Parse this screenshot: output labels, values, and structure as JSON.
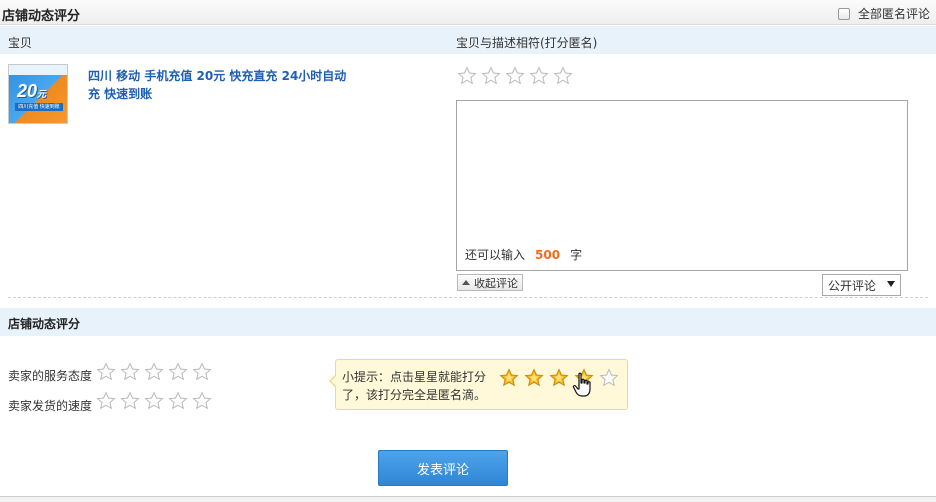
{
  "header": {
    "title": "店铺动态评分",
    "anonymous_label": "全部匿名评论"
  },
  "columns": {
    "item": "宝贝",
    "match": "宝贝与描述相符(打分匿名)"
  },
  "product": {
    "thumb_number": "20",
    "thumb_unit": "元",
    "thumb_caption": "四川充值 快速到账",
    "title": "四川 移动 手机充值 20元 快充直充 24小时自动充 快速到账"
  },
  "comment": {
    "remain_prefix": "还可以输入",
    "remain_count": "500",
    "remain_suffix": "字"
  },
  "controls": {
    "collapse_label": "收起评论",
    "visibility_selected": "公开评论"
  },
  "shop_rating": {
    "title": "店铺动态评分",
    "service_label": "卖家的服务态度",
    "shipping_label": "卖家发货的速度"
  },
  "tip": {
    "text": "小提示：点击星星就能打分了，该打分完全是匿名滴。",
    "demo_filled": 4,
    "demo_total": 5
  },
  "submit_label": "发表评论",
  "colors": {
    "accent": "#2f86d6",
    "link": "#1e5fb4",
    "count": "#f06c1c",
    "star_filled": "#f5b81e"
  },
  "icons": {
    "star_empty": "star-outline-icon",
    "star_filled": "star-filled-icon",
    "cursor": "hand-pointer-icon"
  }
}
